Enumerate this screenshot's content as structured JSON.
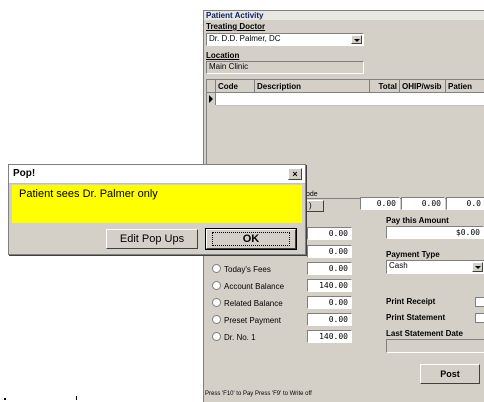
{
  "window": {
    "title": "Patient Activity",
    "treating_doctor_label": "Treating Doctor",
    "doctor_value": "Dr. D.D. Palmer, DC",
    "location_label": "Location",
    "location_value": "Main Clinic"
  },
  "grid": {
    "headers": [
      "Code",
      "Description",
      "Total",
      "OHIP/wsib",
      "Patien"
    ]
  },
  "totals_row": {
    "code_label": "ode",
    "btn_text": ")",
    "values": [
      "0.00",
      "0.00",
      "0.0"
    ]
  },
  "pay": {
    "pay_label": "Pay this Amount",
    "pay_value": "$0.00",
    "payment_type_label": "Payment Type",
    "payment_type_value": "Cash",
    "print_receipt_label": "Print Receipt",
    "print_statement_label": "Print Statement",
    "last_statement_label": "Last Statement Date",
    "post_label": "Post"
  },
  "radios": [
    {
      "label": "",
      "value": "0.00"
    },
    {
      "label": "",
      "value": "0.00"
    },
    {
      "label": "Today's Fees",
      "value": "0.00"
    },
    {
      "label": "Account Balance",
      "value": "140.00"
    },
    {
      "label": "Related Balance",
      "value": "0.00"
    },
    {
      "label": "Preset Payment",
      "value": "0.00"
    },
    {
      "label": "Dr. No. 1",
      "value": "140.00"
    }
  ],
  "status_text": "Press 'F10' to Pay   Press 'F9' to Write off",
  "popup": {
    "title": "Pop!",
    "close": "×",
    "message": "Patient sees Dr. Palmer only",
    "edit_button": "Edit Pop Ups",
    "ok_button": "OK"
  }
}
